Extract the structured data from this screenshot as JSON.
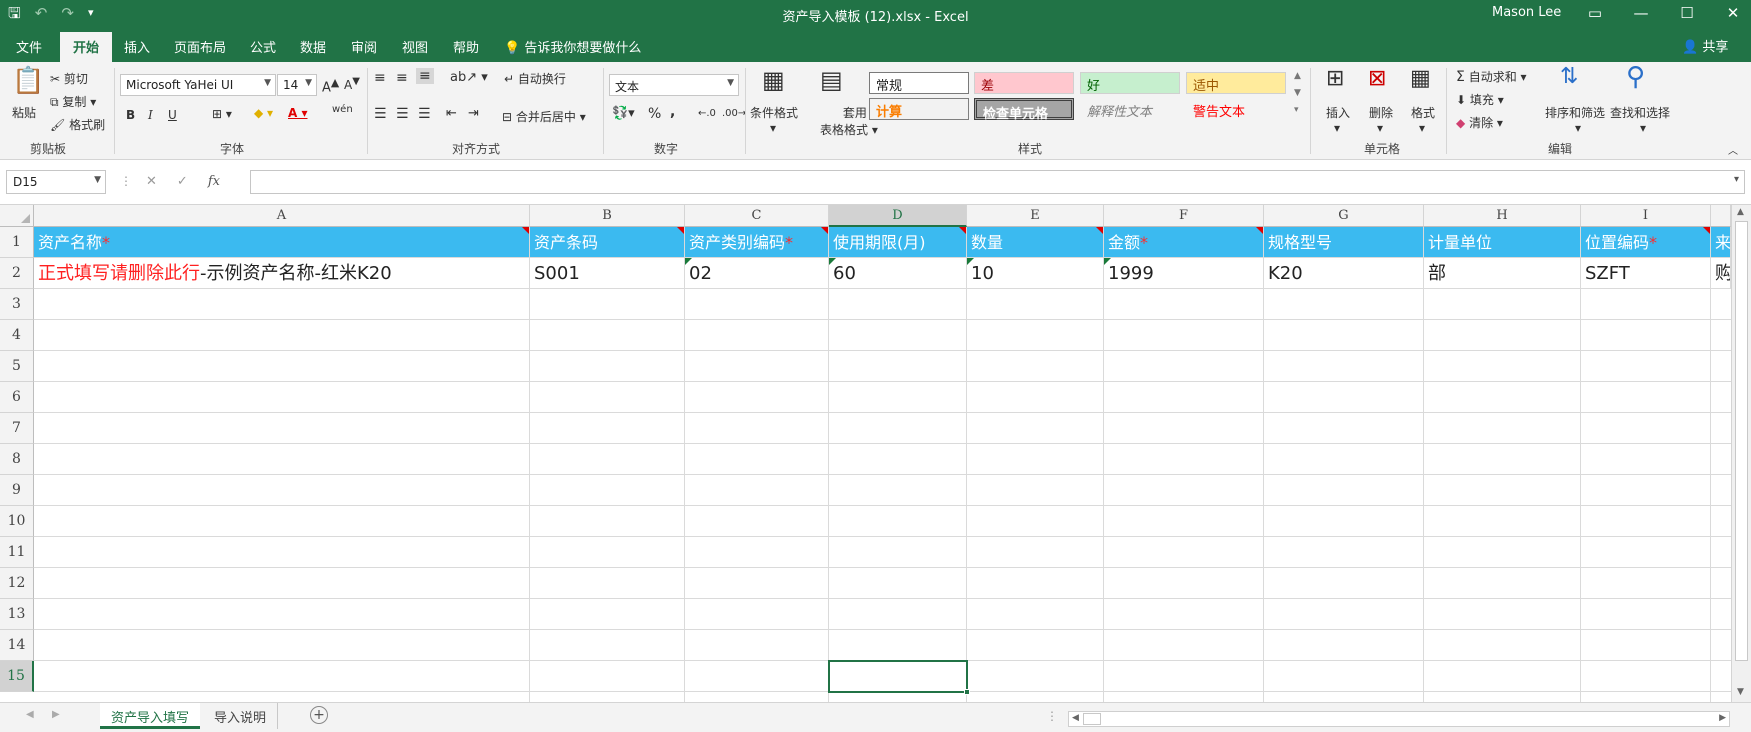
{
  "app": {
    "title": "资产导入模板 (12).xlsx  -  Excel",
    "user": "Mason Lee",
    "tell_me": "告诉我你想要做什么",
    "share": "共享",
    "accent": "#217346"
  },
  "tabs": [
    "文件",
    "开始",
    "插入",
    "页面布局",
    "公式",
    "数据",
    "审阅",
    "视图",
    "帮助"
  ],
  "ribbon": {
    "clipboard": {
      "paste": "粘贴",
      "cut": "剪切",
      "copy": "复制",
      "format_painter": "格式刷",
      "label": "剪贴板"
    },
    "font": {
      "name": "Microsoft YaHei UI",
      "size": "14",
      "label": "字体",
      "bold": "B",
      "italic": "I",
      "underline": "U",
      "phonetic": "wén"
    },
    "alignment": {
      "wrap": "自动换行",
      "merge": "合并后居中",
      "label": "对齐方式"
    },
    "number": {
      "format": "文本",
      "label": "数字",
      "percent": "%",
      "comma": ","
    },
    "styles": {
      "conditional": "条件格式",
      "table_line1": "套用",
      "table_line2": "表格格式",
      "label": "样式",
      "cells": [
        "常规",
        "差",
        "好",
        "适中",
        "计算",
        "检查单元格",
        "解释性文本",
        "警告文本"
      ]
    },
    "cells": {
      "insert": "插入",
      "delete": "删除",
      "format": "格式",
      "label": "单元格"
    },
    "editing": {
      "autosum": "自动求和",
      "fill": "填充",
      "clear": "清除",
      "sort": "排序和筛选",
      "find": "查找和选择",
      "label": "编辑"
    }
  },
  "formula_bar": {
    "name_box": "D15",
    "fx": "fx",
    "value": ""
  },
  "columns": [
    "A",
    "B",
    "C",
    "D",
    "E",
    "F",
    "G",
    "H",
    "I"
  ],
  "rows": [
    "1",
    "2",
    "3",
    "4",
    "5",
    "6",
    "7",
    "8",
    "9",
    "10",
    "11",
    "12",
    "13",
    "14",
    "15"
  ],
  "header_row": [
    {
      "text": "资产名称",
      "star": "*"
    },
    {
      "text": "资产条码",
      "star": ""
    },
    {
      "text": "资产类别编码",
      "star": "*"
    },
    {
      "text": "使用期限(月)",
      "star": ""
    },
    {
      "text": "数量",
      "star": ""
    },
    {
      "text": "金额",
      "star": "*"
    },
    {
      "text": "规格型号",
      "star": ""
    },
    {
      "text": "计量单位",
      "star": ""
    },
    {
      "text": "位置编码",
      "star": "*"
    },
    {
      "text": "来",
      "star": ""
    }
  ],
  "example_row": {
    "a_red": "正式填写请删除此行",
    "a_rest": "-示例资产名称-红米K20",
    "cells": [
      "S001",
      "02",
      "60",
      "10",
      "1999",
      "K20",
      "部",
      "SZFT",
      "购"
    ]
  },
  "sheets": [
    "资产导入填写",
    "导入说明"
  ],
  "add_sheet": "+"
}
